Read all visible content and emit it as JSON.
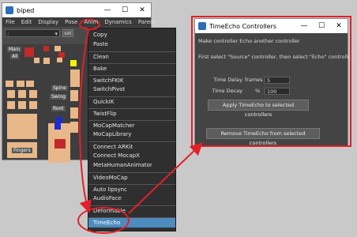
{
  "biped": {
    "title": "biped",
    "window_controls": {
      "minimize": "—",
      "maximize": "☐",
      "close": "✕"
    },
    "menubar": [
      "File",
      "Edit",
      "Display",
      "Pose",
      "Anim",
      "Dynamics",
      "Parent"
    ],
    "selector_value": ":",
    "set_label": "set",
    "labels": {
      "main": "Main",
      "all": "All",
      "spine": "Spine",
      "swing": "Swing",
      "root": "Root",
      "fingers": "Fingers"
    }
  },
  "anim_menu": {
    "items": [
      {
        "label": "Copy"
      },
      {
        "label": "Paste"
      },
      {
        "label": "Clean"
      },
      {
        "label": "Bake"
      },
      {
        "label": "SwitchFKIK"
      },
      {
        "label": "SwitchPivot"
      },
      {
        "label": "QuickIK"
      },
      {
        "label": "TwistFlip"
      },
      {
        "label": "MoCapMatcher"
      },
      {
        "label": "MoCapLibrary"
      },
      {
        "label": "Connect ARKit"
      },
      {
        "label": "Connect MocapX"
      },
      {
        "label": "MetaHumanAnimator"
      },
      {
        "label": "VideoMoCap"
      },
      {
        "label": "Auto lipsync"
      },
      {
        "label": "AudioFace"
      },
      {
        "label": "Deformable"
      },
      {
        "label": "TimeEcho"
      }
    ],
    "selected": "TimeEcho"
  },
  "timeecho": {
    "title": "TimeEcho Controllers",
    "window_controls": {
      "minimize": "—",
      "maximize": "☐",
      "close": "✕"
    },
    "line1": "Make controller Echo another controller",
    "line2": "First select \"Source\" controller, then select \"Echo\" controller",
    "delay_label": "Time Delay",
    "delay_unit": "frames",
    "delay_value": "5",
    "decay_label": "Time Decay",
    "decay_unit": "%",
    "decay_value": "100",
    "apply_label": "Apply TimeEcho to selected controllers",
    "remove_label": "Remove TimeEcho from selected controllers"
  },
  "colors": {
    "highlight": "#4d8cbf",
    "annotation": "#e2202a"
  }
}
